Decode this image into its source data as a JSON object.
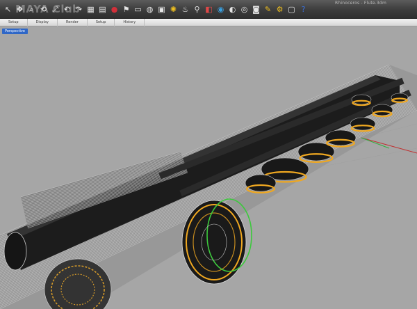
{
  "window": {
    "title": "Rhinoceros - Flute.3dm"
  },
  "watermark": {
    "text": "MAYA Club"
  },
  "toolbar": {
    "icons": [
      {
        "name": "select-arrow-icon",
        "glyph": "↖",
        "color": "#e6e6e6"
      },
      {
        "name": "pan-icon",
        "glyph": "✥",
        "color": "#e6e6e6"
      },
      {
        "name": "zoom-icon",
        "glyph": "⌕",
        "color": "#e6e6e6"
      },
      {
        "name": "rotate-view-icon",
        "glyph": "⟲",
        "color": "#e6e6e6"
      },
      {
        "name": "zoom-extents-icon",
        "glyph": "⤢",
        "color": "#e6e6e6"
      },
      {
        "name": "undo-icon",
        "glyph": "↶",
        "color": "#e6e6e6"
      },
      {
        "name": "redo-icon",
        "glyph": "↷",
        "color": "#e6e6e6"
      },
      {
        "name": "four-viewports-icon",
        "glyph": "▦",
        "color": "#e6e6e6"
      },
      {
        "name": "paste-icon",
        "glyph": "▤",
        "color": "#e6e6e6"
      },
      {
        "name": "record-icon",
        "glyph": "●",
        "color": "#d2303a"
      },
      {
        "name": "flag-icon",
        "glyph": "⚑",
        "color": "#e6e6e6"
      },
      {
        "name": "cplane-icon",
        "glyph": "▭",
        "color": "#e6e6e6"
      },
      {
        "name": "globe-icon",
        "glyph": "◍",
        "color": "#e6e6e6"
      },
      {
        "name": "properties-icon",
        "glyph": "▣",
        "color": "#e6e6e6"
      },
      {
        "name": "light-sun-icon",
        "glyph": "✺",
        "color": "#f0c020"
      },
      {
        "name": "light-bulb-icon",
        "glyph": "♨",
        "color": "#e6e6e6"
      },
      {
        "name": "spotlight-icon",
        "glyph": "⚲",
        "color": "#e6e6e6"
      },
      {
        "name": "render-preview-icon",
        "glyph": "◧",
        "color": "#e04848"
      },
      {
        "name": "color-wheel-icon",
        "glyph": "◉",
        "color": "#3aa0e0"
      },
      {
        "name": "material-sphere-icon",
        "glyph": "◐",
        "color": "#e6e6e6"
      },
      {
        "name": "environment-icon",
        "glyph": "◎",
        "color": "#e6e6e6"
      },
      {
        "name": "snapshot-icon",
        "glyph": "◙",
        "color": "#e6e6e6"
      },
      {
        "name": "notes-icon",
        "glyph": "✎",
        "color": "#f0c020"
      },
      {
        "name": "settings-gear-icon",
        "glyph": "⚙",
        "color": "#f0c020"
      },
      {
        "name": "preview-icon",
        "glyph": "▢",
        "color": "#e6e6e6"
      },
      {
        "name": "help-icon",
        "glyph": "?",
        "color": "#3a6fd8"
      }
    ]
  },
  "tabs": [
    {
      "label": "Setup"
    },
    {
      "label": "Display"
    },
    {
      "label": "Render"
    },
    {
      "label": "Setup"
    },
    {
      "label": "History"
    }
  ],
  "viewport": {
    "label": "Perspective"
  },
  "colors": {
    "background": "#a6a6a6",
    "tube": "#1d1d1d",
    "wire": "#d9d9d9",
    "key_ring": "#f0a820",
    "highlight": "#3cc93c",
    "axis_x": "#c03030",
    "axis_y": "#30b040"
  }
}
